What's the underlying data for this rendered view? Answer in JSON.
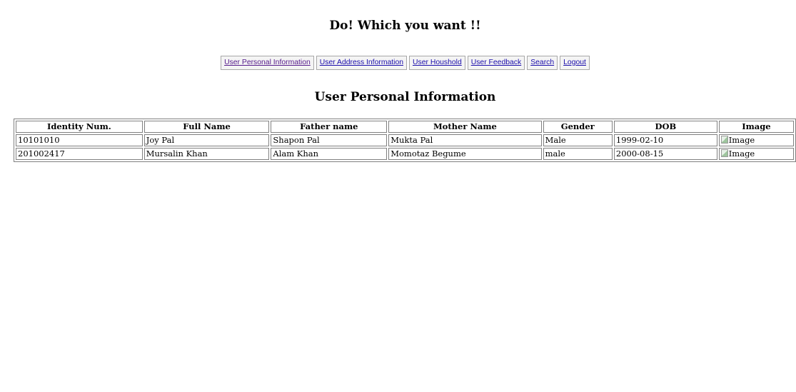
{
  "header": {
    "title": "Do! Which you want !!"
  },
  "nav": {
    "items": [
      {
        "label": "User Personal Information"
      },
      {
        "label": "User Address Information"
      },
      {
        "label": "User Houshold"
      },
      {
        "label": "User Feedback"
      },
      {
        "label": "Search"
      },
      {
        "label": "Logout"
      }
    ]
  },
  "main": {
    "section_title": "User Personal Information",
    "table": {
      "columns": [
        "Identity Num.",
        "Full Name",
        "Father name",
        "Mother Name",
        "Gender",
        "DOB",
        "Image"
      ],
      "rows": [
        {
          "identity": "10101010",
          "full_name": "Joy Pal",
          "father": "Shapon Pal",
          "mother": "Mukta Pal",
          "gender": "Male",
          "dob": "1999-02-10",
          "image_alt": "Image"
        },
        {
          "identity": "201002417",
          "full_name": "Mursalin Khan",
          "father": "Alam Khan",
          "mother": "Momotaz Begume",
          "gender": "male",
          "dob": "2000-08-15",
          "image_alt": "Image"
        }
      ]
    }
  }
}
